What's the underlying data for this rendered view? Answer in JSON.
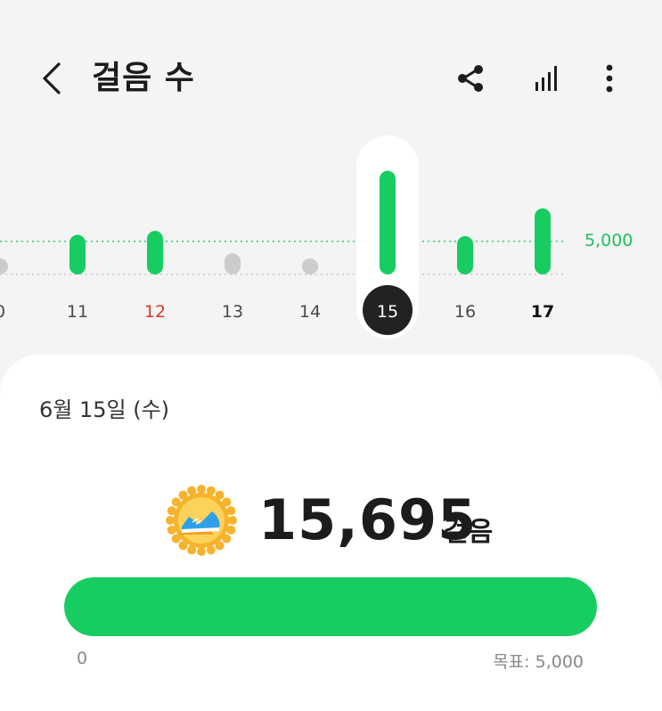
{
  "header": {
    "title": "걸음 수",
    "icons": [
      "back-icon",
      "share-icon",
      "bar-chart-icon",
      "more-vertical-icon"
    ]
  },
  "colors": {
    "accent": "#17cd62",
    "inactive": "#cccccc",
    "sunday": "#d33a2c",
    "selected_badge": "#222222"
  },
  "chart": {
    "goal_label": "5,000",
    "days": [
      {
        "label": "0",
        "state": "low"
      },
      {
        "label": "11",
        "state": "normal"
      },
      {
        "label": "12",
        "state": "sunday"
      },
      {
        "label": "13",
        "state": "low"
      },
      {
        "label": "14",
        "state": "low"
      },
      {
        "label": "15",
        "state": "selected"
      },
      {
        "label": "16",
        "state": "normal"
      },
      {
        "label": "17",
        "state": "today"
      }
    ]
  },
  "chart_data": {
    "type": "bar",
    "categories": [
      "0",
      "11",
      "12",
      "13",
      "14",
      "15",
      "16",
      "17"
    ],
    "values": [
      1400,
      6000,
      6600,
      3200,
      1000,
      15695,
      5800,
      10000
    ],
    "goal": 5000,
    "ylim": [
      0,
      17000
    ],
    "grid": false
  },
  "summary": {
    "date": "6월 15일 (수)",
    "steps": "15,695",
    "unit": "걸음",
    "medal_icon": "sneaker-medal-icon",
    "progress_fraction": 1.0,
    "min_label": "0",
    "goal_label": "목표: 5,000"
  }
}
